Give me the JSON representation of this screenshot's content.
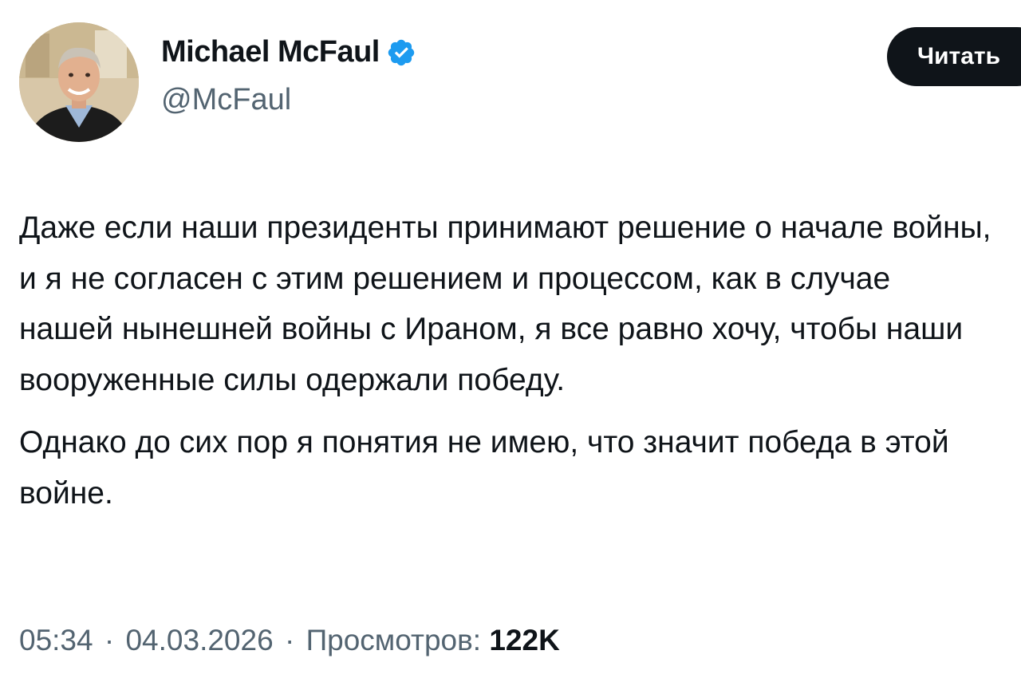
{
  "author": {
    "display_name": "Michael McFaul",
    "handle": "@McFaul",
    "avatar_icon": "profile-photo",
    "verified_icon": "verified-badge-icon",
    "verified_color": "#1d9bf0"
  },
  "follow_button": {
    "label": "Читать"
  },
  "tweet": {
    "paragraphs": [
      "Даже если наши президенты принимают решение о начале войны, и я не согласен с этим решением и процессом, как в случае нашей нынешней войны с Ираном, я все равно хочу, чтобы наши вооруженные силы одержали победу.",
      "Однако до сих пор я понятия не имею, что значит победа в этой войне."
    ]
  },
  "meta": {
    "time": "05:34",
    "date": "04.03.2026",
    "separator": "·",
    "views_label": "Просмотров:",
    "views_count": "122K"
  }
}
